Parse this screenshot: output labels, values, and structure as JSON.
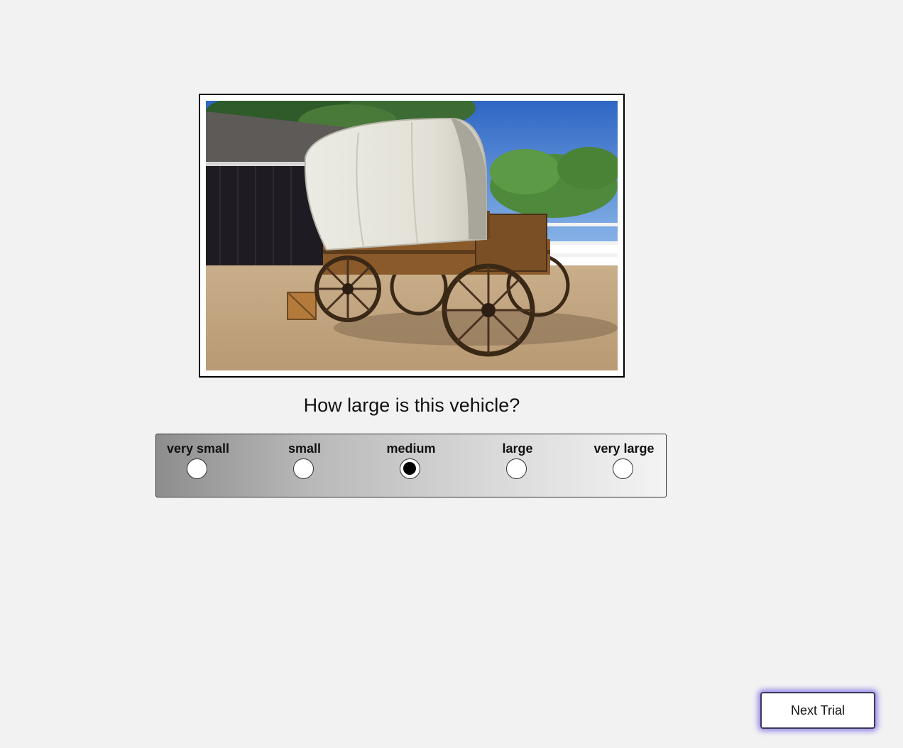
{
  "question": "How large is this vehicle?",
  "image": {
    "subject": "covered-wagon-photo"
  },
  "scale": {
    "options": [
      {
        "label": "very small",
        "selected": false
      },
      {
        "label": "small",
        "selected": false
      },
      {
        "label": "medium",
        "selected": true
      },
      {
        "label": "large",
        "selected": false
      },
      {
        "label": "very large",
        "selected": false
      }
    ]
  },
  "next_button": {
    "label": "Next Trial"
  }
}
